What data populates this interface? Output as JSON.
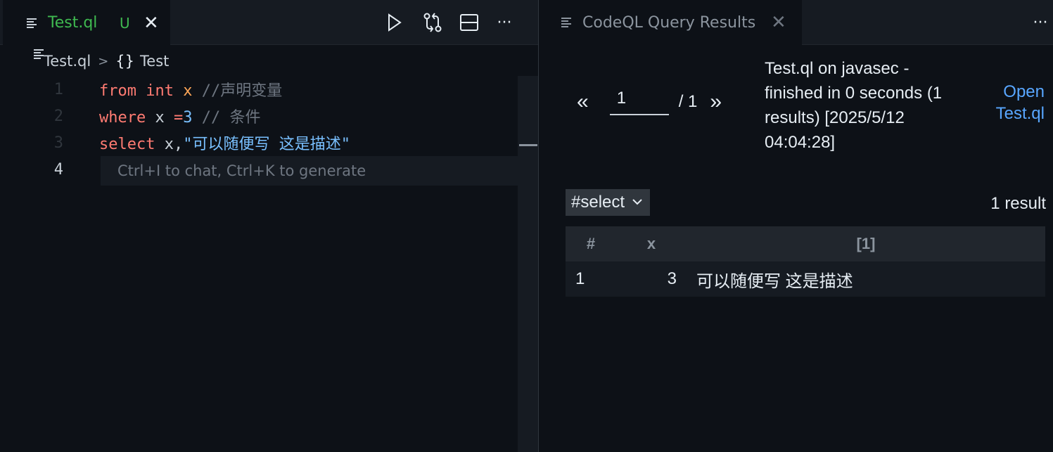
{
  "left_tab": {
    "filename": "Test.ql",
    "status": "U",
    "close": "✕"
  },
  "left_actions": {
    "run": "▷",
    "more": "···"
  },
  "breadcrumb": {
    "file": "Test.ql",
    "sep": ">",
    "brace": "{}",
    "symbol": "Test"
  },
  "editor": {
    "line_numbers": [
      "1",
      "2",
      "3",
      "4"
    ],
    "line1": {
      "kw1": "from",
      "type": "int",
      "var": "x",
      "comment": "//声明变量"
    },
    "line2": {
      "kw": "where",
      "var": "x",
      "op": "=",
      "num": "3",
      "comment": "// 条件"
    },
    "line3": {
      "kw": "select",
      "var": "x,",
      "str": "\"可以随便写 这是描述\""
    },
    "ghost_hint": "Ctrl+I to chat, Ctrl+K to generate"
  },
  "right_tab": {
    "title": "CodeQL Query Results",
    "close": "✕",
    "more": "···"
  },
  "results": {
    "prev": "«",
    "page": "1",
    "total": "/ 1",
    "next": "»",
    "summary": "Test.ql on javasec - finished in 0 seconds (1 results) [2025/5/12 04:04:28]",
    "open_link": "Open Test.ql",
    "result_set": "#select",
    "result_count": "1 result",
    "columns": [
      "#",
      "x",
      "[1]"
    ],
    "rows": [
      [
        "1",
        "3",
        "可以随便写 这是描述"
      ]
    ]
  }
}
